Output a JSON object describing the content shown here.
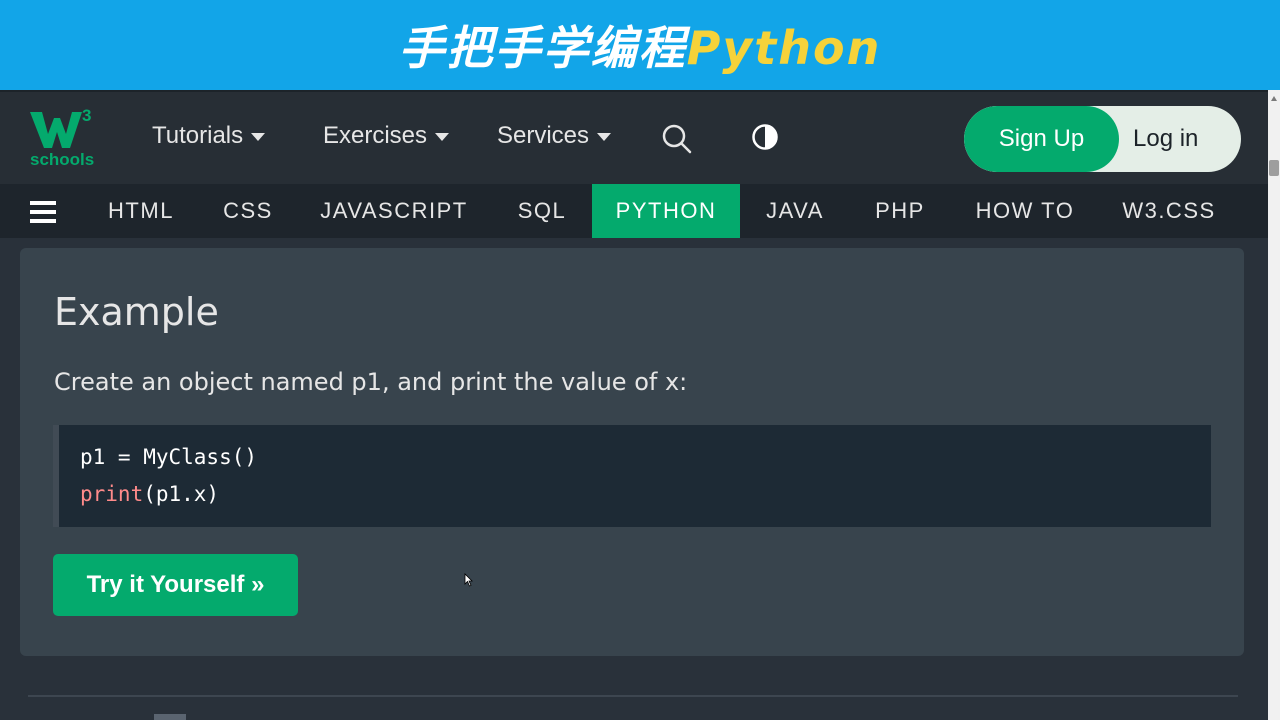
{
  "banner": {
    "title_cn": "手把手学编程",
    "title_en": "Python",
    "accent_color": "#f5d23a"
  },
  "header": {
    "logo_sup": "3",
    "logo_text": "schools",
    "menus": [
      {
        "label": "Tutorials"
      },
      {
        "label": "Exercises"
      },
      {
        "label": "Services"
      }
    ],
    "icons": [
      "search-icon",
      "contrast-icon"
    ],
    "signup_label": "Sign Up",
    "login_label": "Log in",
    "brand_color": "#04aa6d"
  },
  "subnav": {
    "items": [
      {
        "label": "HTML"
      },
      {
        "label": "CSS"
      },
      {
        "label": "JAVASCRIPT"
      },
      {
        "label": "SQL"
      },
      {
        "label": "PYTHON",
        "active": true
      },
      {
        "label": "JAVA"
      },
      {
        "label": "PHP"
      },
      {
        "label": "HOW TO"
      },
      {
        "label": "W3.CSS"
      }
    ]
  },
  "example": {
    "title": "Example",
    "description": "Create an object named p1, and print the value of x:",
    "code": {
      "line1": "p1 = MyClass()",
      "line2_keyword": "print",
      "line2_rest": "(p1.x)"
    },
    "try_button": "Try it Yourself »"
  }
}
